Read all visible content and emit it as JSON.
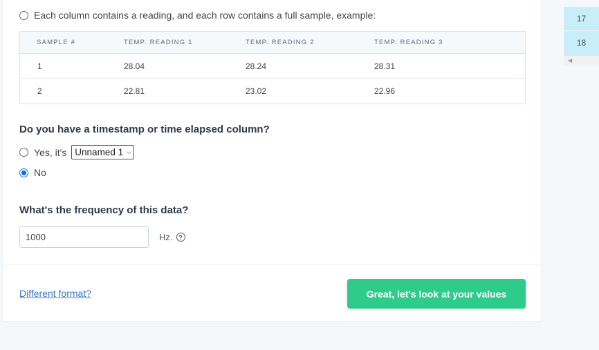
{
  "format_option": {
    "label": "Each column contains a reading, and each row contains a full sample, example:"
  },
  "sample_table": {
    "headers": [
      "SAMPLE #",
      "TEMP. READING 1",
      "TEMP. READING 2",
      "TEMP. READING 3"
    ],
    "rows": [
      [
        "1",
        "28.04",
        "28.24",
        "28.31"
      ],
      [
        "2",
        "22.81",
        "23.02",
        "22.96"
      ]
    ]
  },
  "timestamp_question": {
    "title": "Do you have a timestamp or time elapsed column?",
    "yes_label": "Yes, it's",
    "select_value": "Unnamed 1",
    "no_label": "No",
    "selected": "no"
  },
  "frequency_question": {
    "title": "What's the frequency of this data?",
    "input_value": "1000",
    "unit": "Hz."
  },
  "footer": {
    "different_format_link": "Different format?",
    "continue_button": "Great, let's look at your values"
  },
  "side_panel": {
    "row_numbers": [
      "17",
      "18"
    ]
  },
  "colors": {
    "accent_green": "#2ecc8a",
    "link_blue": "#3a79c7",
    "radio_blue": "#0b6fd8"
  }
}
